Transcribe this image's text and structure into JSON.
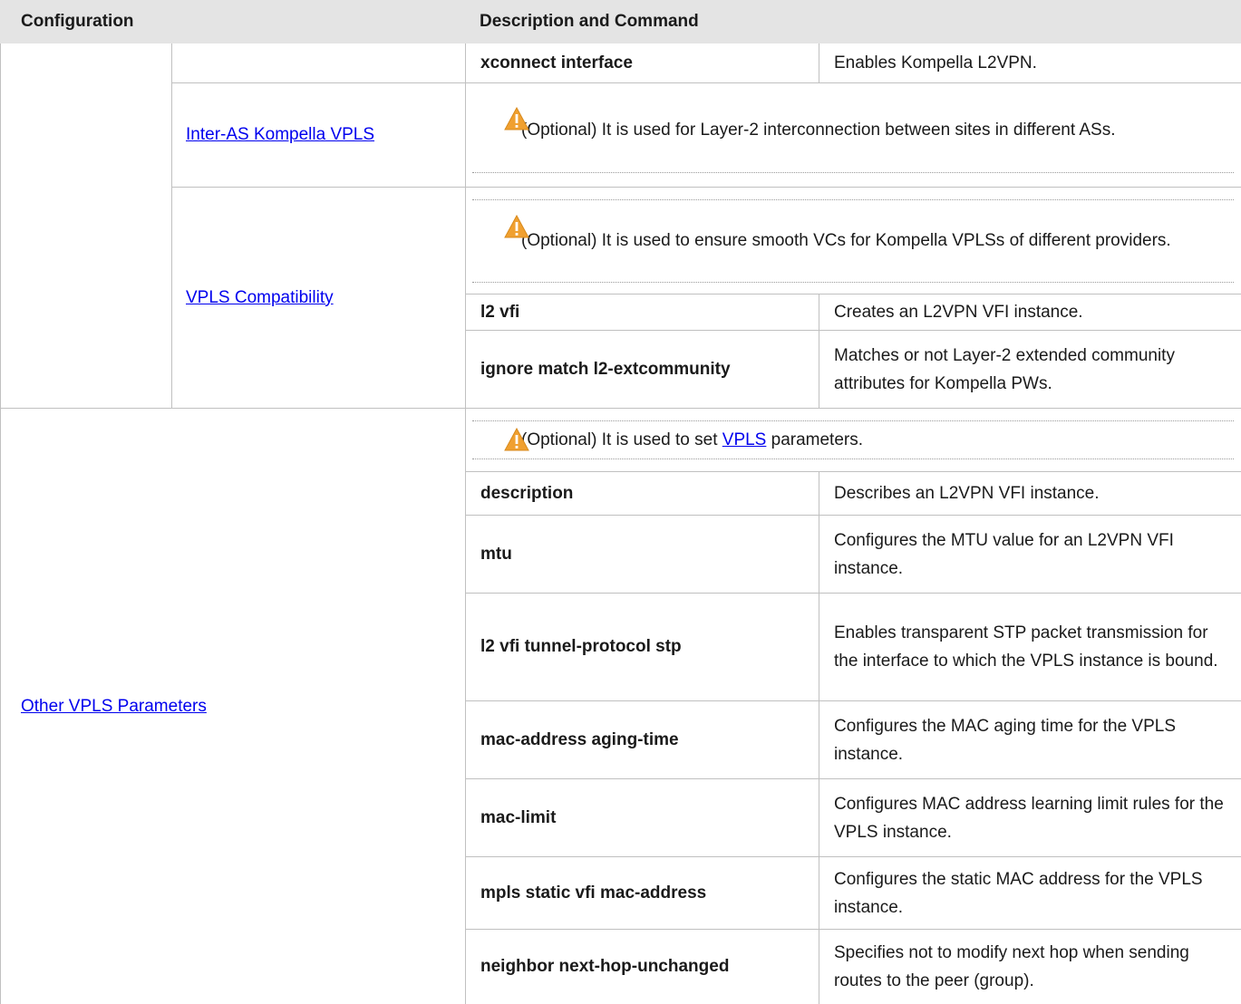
{
  "header": {
    "configuration": "Configuration",
    "description_and_command": "Description and Command"
  },
  "rows": {
    "xconnect": {
      "command": "xconnect interface",
      "description": "Enables Kompella L2VPN."
    },
    "inter_as": {
      "link": "Inter-AS Kompella VPLS",
      "note": "(Optional) It is used for Layer-2 interconnection between sites in different ASs."
    },
    "compat": {
      "link": "VPLS Compatibility",
      "note": "(Optional) It is used to ensure smooth VCs for Kompella VPLSs of different providers.",
      "commands": [
        {
          "command": "l2 vfi",
          "description": "Creates an L2VPN VFI instance."
        },
        {
          "command": "ignore match l2-extcommunity",
          "description": "Matches or not Layer-2 extended community attributes for Kompella PWs."
        }
      ]
    },
    "other": {
      "link": "Other VPLS Parameters",
      "note_prefix": "(Optional) It is used to set ",
      "note_link": "VPLS",
      "note_suffix": " parameters.",
      "commands": [
        {
          "command": "description",
          "description": "Describes an L2VPN VFI instance."
        },
        {
          "command": "mtu",
          "description": "Configures the MTU value for an L2VPN VFI instance."
        },
        {
          "command": "l2 vfi tunnel-protocol stp",
          "description": "Enables transparent STP packet transmission for the interface to which the VPLS instance is bound."
        },
        {
          "command": "mac-address aging-time",
          "description": "Configures the MAC aging time for the VPLS instance."
        },
        {
          "command": "mac-limit",
          "description": "Configures MAC address learning limit rules for the VPLS instance."
        },
        {
          "command": "mpls static vfi mac-address",
          "description": "Configures the static MAC address for the VPLS instance."
        },
        {
          "command": "neighbor next-hop-unchanged",
          "description": "Specifies not to modify next hop when sending routes to the peer (group)."
        }
      ]
    }
  },
  "icons": {
    "warning": "warning-icon"
  },
  "colors": {
    "link": "#0000ee",
    "header_bg": "#e4e4e4",
    "warning": "#f0a030"
  }
}
